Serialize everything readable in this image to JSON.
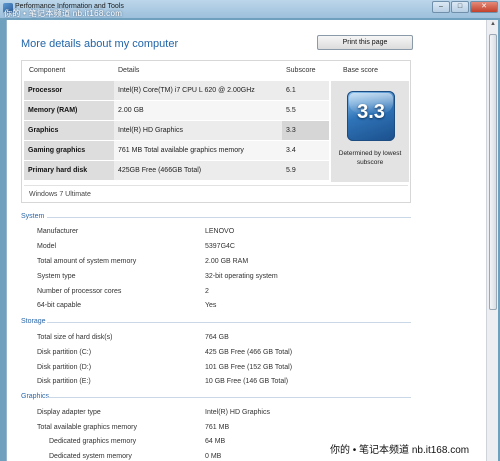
{
  "window": {
    "title": "Performance Information and Tools",
    "watermark_top": "你的 • 笔记本频道  nb.it168.com",
    "minimize": "–",
    "maximize": "□",
    "close": "✕"
  },
  "header": {
    "title": "More details about my computer",
    "print_button": "Print this page"
  },
  "score_table": {
    "columns": [
      "Component",
      "Details",
      "Subscore",
      "Base score"
    ],
    "rows": [
      {
        "component": "Processor",
        "details": "Intel(R) Core(TM) i7 CPU L 620 @ 2.00GHz",
        "subscore": "6.1"
      },
      {
        "component": "Memory (RAM)",
        "details": "2.00 GB",
        "subscore": "5.5"
      },
      {
        "component": "Graphics",
        "details": "Intel(R) HD Graphics",
        "subscore": "3.3"
      },
      {
        "component": "Gaming graphics",
        "details": "761 MB Total available graphics memory",
        "subscore": "3.4"
      },
      {
        "component": "Primary hard disk",
        "details": "425GB Free (466GB Total)",
        "subscore": "5.9"
      }
    ],
    "base_score": "3.3",
    "base_caption": "Determined by lowest subscore",
    "os": "Windows 7 Ultimate"
  },
  "system": {
    "title": "System",
    "items": [
      {
        "label": "Manufacturer",
        "value": "LENOVO"
      },
      {
        "label": "Model",
        "value": "5397G4C"
      },
      {
        "label": "Total amount of system memory",
        "value": "2.00 GB RAM"
      },
      {
        "label": "System type",
        "value": "32-bit operating system"
      },
      {
        "label": "Number of processor cores",
        "value": "2"
      },
      {
        "label": "64-bit capable",
        "value": "Yes"
      }
    ]
  },
  "storage": {
    "title": "Storage",
    "items": [
      {
        "label": "Total size of hard disk(s)",
        "value": "764 GB"
      },
      {
        "label": "Disk partition (C:)",
        "value": "425 GB Free (466 GB Total)"
      },
      {
        "label": "Disk partition (D:)",
        "value": "101 GB Free (152 GB Total)"
      },
      {
        "label": "Disk partition (E:)",
        "value": "10 GB Free (146 GB Total)"
      }
    ]
  },
  "graphics": {
    "title": "Graphics",
    "items": [
      {
        "label": "Display adapter type",
        "value": "Intel(R) HD Graphics"
      },
      {
        "label": "Total available graphics memory",
        "value": "761 MB"
      },
      {
        "label": "Dedicated graphics memory",
        "value": "64 MB"
      },
      {
        "label": "Dedicated system memory",
        "value": "0 MB"
      }
    ]
  },
  "watermark_bottom": "你的 • 笔记本频道  nb.it168.com"
}
